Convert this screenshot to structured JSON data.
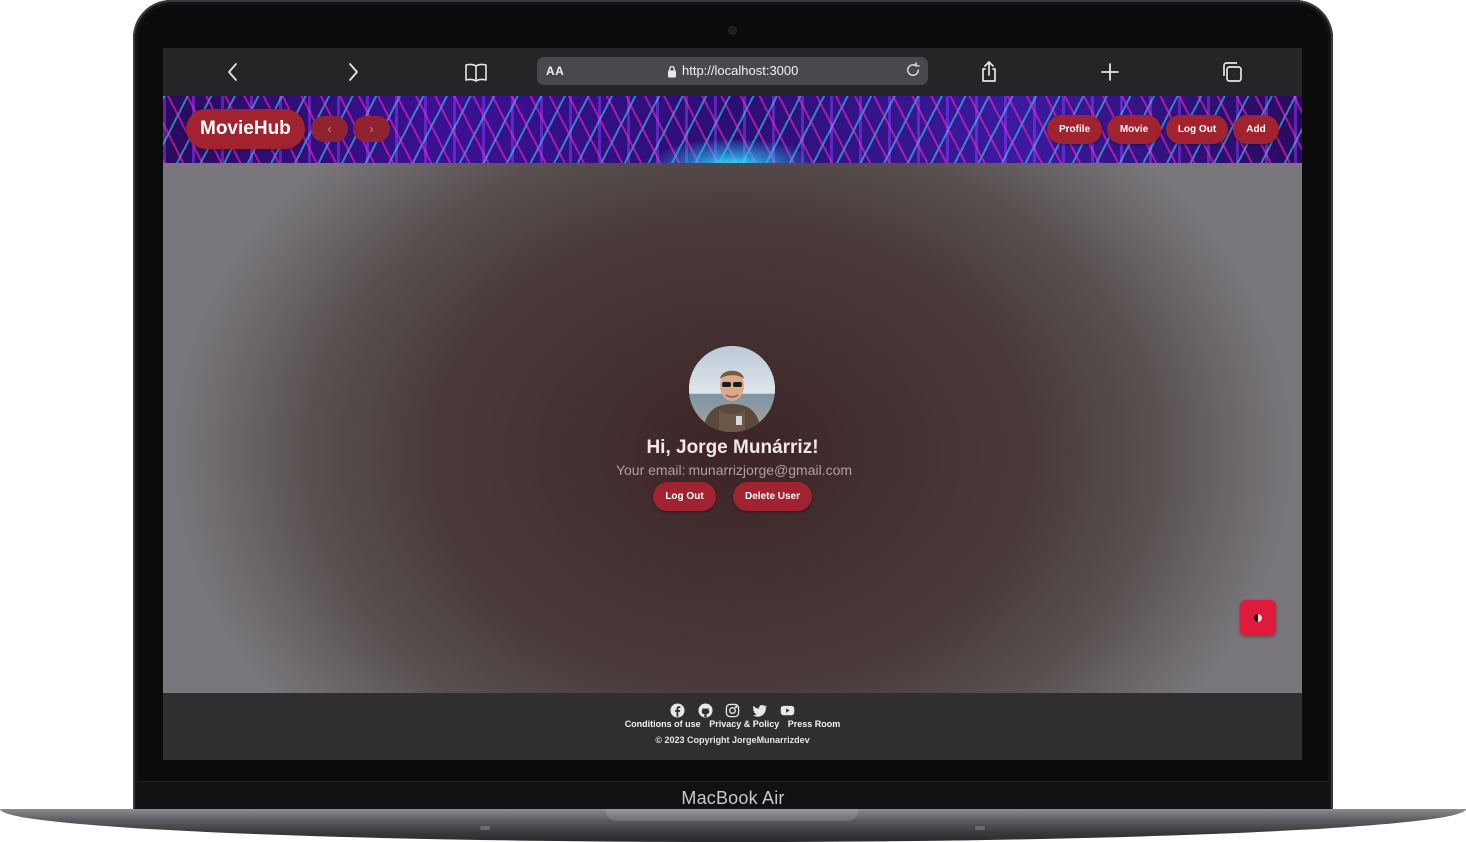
{
  "browser": {
    "url": "http://localhost:3000",
    "reader_label": "AA"
  },
  "header": {
    "brand": "MovieHub",
    "back_arrow": "‹",
    "forward_arrow": "›",
    "nav": {
      "profile": "Profile",
      "movie": "Movie",
      "logout": "Log Out",
      "add": "Add"
    }
  },
  "profile": {
    "greeting": "Hi, Jorge Munárriz!",
    "email_label": "Your email:",
    "email": "munarrizjorge@gmail.com",
    "logout_button": "Log Out",
    "delete_button": "Delete User"
  },
  "footer": {
    "social_icons": [
      "facebook-icon",
      "github-icon",
      "instagram-icon",
      "twitter-icon",
      "youtube-icon"
    ],
    "links": [
      "Conditions of use",
      "Privacy & Policy",
      "Press Room"
    ],
    "copyright": "© 2023 Copyright JorgeMunarrizdev"
  },
  "device": {
    "label": "MacBook Air"
  },
  "colors": {
    "accent": "#a1232f",
    "toggle": "#e01a3c",
    "footer_bg": "#2f2f2f"
  }
}
